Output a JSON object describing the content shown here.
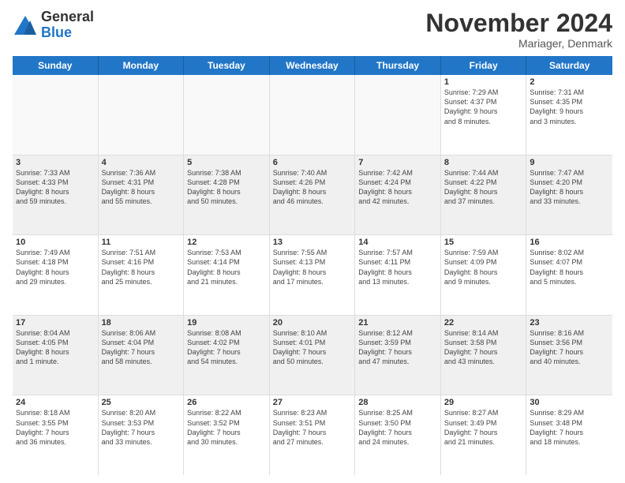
{
  "logo": {
    "general": "General",
    "blue": "Blue"
  },
  "title": "November 2024",
  "location": "Mariager, Denmark",
  "days_of_week": [
    "Sunday",
    "Monday",
    "Tuesday",
    "Wednesday",
    "Thursday",
    "Friday",
    "Saturday"
  ],
  "weeks": [
    [
      {
        "day": "",
        "info": "",
        "empty": true
      },
      {
        "day": "",
        "info": "",
        "empty": true
      },
      {
        "day": "",
        "info": "",
        "empty": true
      },
      {
        "day": "",
        "info": "",
        "empty": true
      },
      {
        "day": "",
        "info": "",
        "empty": true
      },
      {
        "day": "1",
        "info": "Sunrise: 7:29 AM\nSunset: 4:37 PM\nDaylight: 9 hours\nand 8 minutes.",
        "empty": false
      },
      {
        "day": "2",
        "info": "Sunrise: 7:31 AM\nSunset: 4:35 PM\nDaylight: 9 hours\nand 3 minutes.",
        "empty": false
      }
    ],
    [
      {
        "day": "3",
        "info": "Sunrise: 7:33 AM\nSunset: 4:33 PM\nDaylight: 8 hours\nand 59 minutes.",
        "empty": false
      },
      {
        "day": "4",
        "info": "Sunrise: 7:36 AM\nSunset: 4:31 PM\nDaylight: 8 hours\nand 55 minutes.",
        "empty": false
      },
      {
        "day": "5",
        "info": "Sunrise: 7:38 AM\nSunset: 4:28 PM\nDaylight: 8 hours\nand 50 minutes.",
        "empty": false
      },
      {
        "day": "6",
        "info": "Sunrise: 7:40 AM\nSunset: 4:26 PM\nDaylight: 8 hours\nand 46 minutes.",
        "empty": false
      },
      {
        "day": "7",
        "info": "Sunrise: 7:42 AM\nSunset: 4:24 PM\nDaylight: 8 hours\nand 42 minutes.",
        "empty": false
      },
      {
        "day": "8",
        "info": "Sunrise: 7:44 AM\nSunset: 4:22 PM\nDaylight: 8 hours\nand 37 minutes.",
        "empty": false
      },
      {
        "day": "9",
        "info": "Sunrise: 7:47 AM\nSunset: 4:20 PM\nDaylight: 8 hours\nand 33 minutes.",
        "empty": false
      }
    ],
    [
      {
        "day": "10",
        "info": "Sunrise: 7:49 AM\nSunset: 4:18 PM\nDaylight: 8 hours\nand 29 minutes.",
        "empty": false
      },
      {
        "day": "11",
        "info": "Sunrise: 7:51 AM\nSunset: 4:16 PM\nDaylight: 8 hours\nand 25 minutes.",
        "empty": false
      },
      {
        "day": "12",
        "info": "Sunrise: 7:53 AM\nSunset: 4:14 PM\nDaylight: 8 hours\nand 21 minutes.",
        "empty": false
      },
      {
        "day": "13",
        "info": "Sunrise: 7:55 AM\nSunset: 4:13 PM\nDaylight: 8 hours\nand 17 minutes.",
        "empty": false
      },
      {
        "day": "14",
        "info": "Sunrise: 7:57 AM\nSunset: 4:11 PM\nDaylight: 8 hours\nand 13 minutes.",
        "empty": false
      },
      {
        "day": "15",
        "info": "Sunrise: 7:59 AM\nSunset: 4:09 PM\nDaylight: 8 hours\nand 9 minutes.",
        "empty": false
      },
      {
        "day": "16",
        "info": "Sunrise: 8:02 AM\nSunset: 4:07 PM\nDaylight: 8 hours\nand 5 minutes.",
        "empty": false
      }
    ],
    [
      {
        "day": "17",
        "info": "Sunrise: 8:04 AM\nSunset: 4:05 PM\nDaylight: 8 hours\nand 1 minute.",
        "empty": false
      },
      {
        "day": "18",
        "info": "Sunrise: 8:06 AM\nSunset: 4:04 PM\nDaylight: 7 hours\nand 58 minutes.",
        "empty": false
      },
      {
        "day": "19",
        "info": "Sunrise: 8:08 AM\nSunset: 4:02 PM\nDaylight: 7 hours\nand 54 minutes.",
        "empty": false
      },
      {
        "day": "20",
        "info": "Sunrise: 8:10 AM\nSunset: 4:01 PM\nDaylight: 7 hours\nand 50 minutes.",
        "empty": false
      },
      {
        "day": "21",
        "info": "Sunrise: 8:12 AM\nSunset: 3:59 PM\nDaylight: 7 hours\nand 47 minutes.",
        "empty": false
      },
      {
        "day": "22",
        "info": "Sunrise: 8:14 AM\nSunset: 3:58 PM\nDaylight: 7 hours\nand 43 minutes.",
        "empty": false
      },
      {
        "day": "23",
        "info": "Sunrise: 8:16 AM\nSunset: 3:56 PM\nDaylight: 7 hours\nand 40 minutes.",
        "empty": false
      }
    ],
    [
      {
        "day": "24",
        "info": "Sunrise: 8:18 AM\nSunset: 3:55 PM\nDaylight: 7 hours\nand 36 minutes.",
        "empty": false
      },
      {
        "day": "25",
        "info": "Sunrise: 8:20 AM\nSunset: 3:53 PM\nDaylight: 7 hours\nand 33 minutes.",
        "empty": false
      },
      {
        "day": "26",
        "info": "Sunrise: 8:22 AM\nSunset: 3:52 PM\nDaylight: 7 hours\nand 30 minutes.",
        "empty": false
      },
      {
        "day": "27",
        "info": "Sunrise: 8:23 AM\nSunset: 3:51 PM\nDaylight: 7 hours\nand 27 minutes.",
        "empty": false
      },
      {
        "day": "28",
        "info": "Sunrise: 8:25 AM\nSunset: 3:50 PM\nDaylight: 7 hours\nand 24 minutes.",
        "empty": false
      },
      {
        "day": "29",
        "info": "Sunrise: 8:27 AM\nSunset: 3:49 PM\nDaylight: 7 hours\nand 21 minutes.",
        "empty": false
      },
      {
        "day": "30",
        "info": "Sunrise: 8:29 AM\nSunset: 3:48 PM\nDaylight: 7 hours\nand 18 minutes.",
        "empty": false
      }
    ]
  ]
}
